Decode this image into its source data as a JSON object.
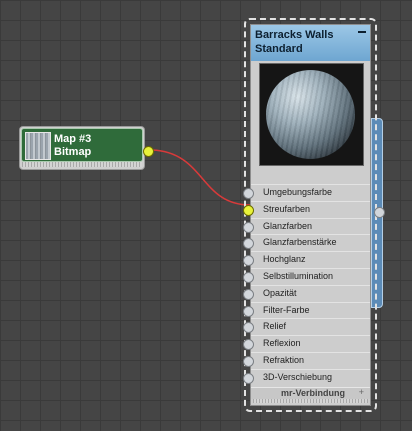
{
  "bitmap_node": {
    "title": "Map #3",
    "subtitle": "Bitmap",
    "header_color": "#2f6b3a"
  },
  "material_node": {
    "title": "Barracks Walls",
    "subtitle": "Standard",
    "header_color": "#8fbfe0",
    "slots": [
      {
        "label": "Umgebungsfarbe",
        "connected": false
      },
      {
        "label": "Streufarben",
        "connected": true
      },
      {
        "label": "Glanzfarben",
        "connected": false
      },
      {
        "label": "Glanzfarbenstärke",
        "connected": false
      },
      {
        "label": "Hochglanz",
        "connected": false
      },
      {
        "label": "Selbstillumination",
        "connected": false
      },
      {
        "label": "Opazität",
        "connected": false
      },
      {
        "label": "Filter-Farbe",
        "connected": false
      },
      {
        "label": "Relief",
        "connected": false
      },
      {
        "label": "Reflexion",
        "connected": false
      },
      {
        "label": "Refraktion",
        "connected": false
      },
      {
        "label": "3D-Verschiebung",
        "connected": false
      }
    ],
    "mr_rollout": "mr-Verbindung"
  },
  "colors": {
    "wire": "#d83a3a",
    "active_socket": "#e8f23a",
    "output_bar": "#5c8bb7"
  }
}
